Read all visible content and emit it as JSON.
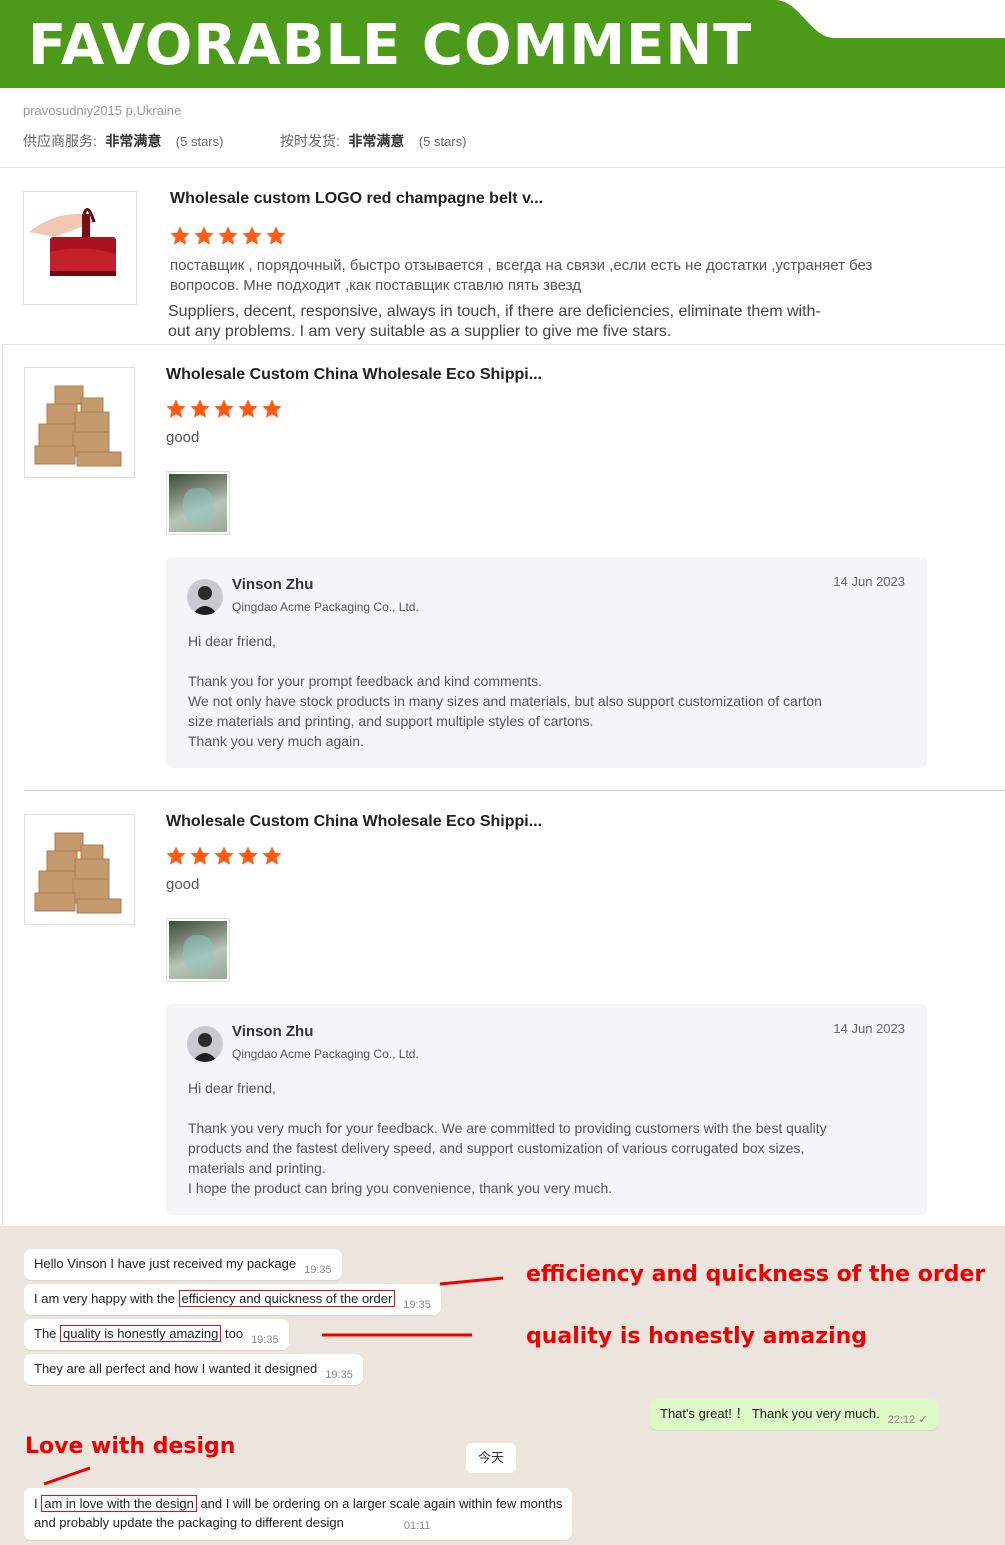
{
  "banner": {
    "title": "FAVORABLE COMMENT",
    "color": "#4c9a1a"
  },
  "reviewer": {
    "name_location": "pravosudniy2015 p,Ukraine",
    "ratings": [
      {
        "label": "供应商服务:",
        "value": "非常满意",
        "note": "(5 stars)"
      },
      {
        "label": "按时发货:",
        "value": "非常满意",
        "note": "(5 stars)"
      }
    ]
  },
  "reviews": [
    {
      "title": "Wholesale custom LOGO red champagne belt v...",
      "stars": 5,
      "text_ru": "поставщик , порядочный, быстро отзывается , всегда на связи ,если есть не достатки ,устраняет без вопросов. Мне подходит ,как поставщик ставлю пять звезд",
      "text_en_1": "Suppliers, decent, responsive, always in touch, if there are deficiencies, eliminate them with-",
      "text_en_2": "out any problems. I am very suitable as a supplier to give me five stars."
    },
    {
      "title": "Wholesale Custom China Wholesale Eco Shippi...",
      "stars": 5,
      "text": "good",
      "reply": {
        "name": "Vinson Zhu",
        "company": "Qingdao Acme Packaging Co., Ltd.",
        "date": "14 Jun 2023",
        "greeting": "Hi dear friend,",
        "line1": "Thank you for your prompt feedback and kind comments.",
        "line2": "We not only have stock products in many sizes and materials, but also support customization of carton",
        "line3": "size materials and printing, and support multiple styles of cartons.",
        "line4": "Thank you very much again."
      }
    },
    {
      "title": "Wholesale Custom China Wholesale Eco Shippi...",
      "stars": 5,
      "text": "good",
      "reply": {
        "name": "Vinson Zhu",
        "company": "Qingdao Acme Packaging Co., Ltd.",
        "date": "14 Jun 2023",
        "greeting": "Hi dear friend,",
        "line1": "Thank you very much for your feedback. We are committed to providing customers with the best quality",
        "line2": "products and the fastest delivery speed, and support customization of various corrugated box sizes,",
        "line3": "materials and printing.",
        "line4": "I hope the product can bring you convenience, thank you very much."
      }
    }
  ],
  "chat": {
    "m1": {
      "text": "Hello Vinson I have just received my package",
      "time": "19:35"
    },
    "m2": {
      "pre": "I am very happy with the ",
      "hl": "efficiency and quickness of the order",
      "post": "",
      "time": "19:35"
    },
    "m3": {
      "pre": "The ",
      "hl": "quality is honestly amazing",
      "post": " too",
      "time": "19:35"
    },
    "m4": {
      "text": "They are all perfect and how I wanted it designed",
      "time": "19:35"
    },
    "m5": {
      "text": "That's great! ！ Thank you very much.",
      "time": "22:12 ✓"
    },
    "day": "今天",
    "m6": {
      "pre": "I ",
      "hl": "am in love with the design",
      "post": " and I will be ordering on a larger scale again within few months",
      "line2": "and probably update the packaging to different design",
      "time": "01:11"
    },
    "annotations": {
      "a1": "efficiency and quickness of the order",
      "a2": "quality is honestly amazing",
      "a3": "Love with design"
    }
  },
  "colors": {
    "star": "#ff5a12",
    "annotation": "#e00000",
    "chat_bg": "#ece5dd"
  }
}
